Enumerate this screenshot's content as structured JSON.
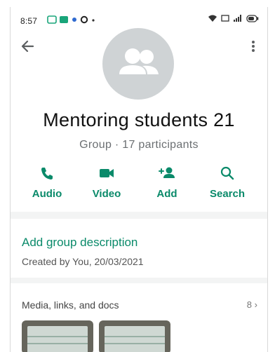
{
  "status_bar": {
    "time": "8:57"
  },
  "header": {
    "group_name": "Mentoring students 21",
    "group_meta": "Group · 17 participants"
  },
  "actions": [
    {
      "label": "Audio",
      "icon": "phone-icon"
    },
    {
      "label": "Video",
      "icon": "video-camera-icon"
    },
    {
      "label": "Add",
      "icon": "add-person-icon"
    },
    {
      "label": "Search",
      "icon": "search-icon"
    }
  ],
  "description": {
    "title": "Add group description",
    "created": "Created by You, 20/03/2021"
  },
  "media": {
    "title": "Media, links, and docs",
    "count": "8"
  },
  "colors": {
    "accent": "#0a8a6a",
    "avatar_bg": "#cfd3d5",
    "page_bg": "#f3f4f4"
  }
}
